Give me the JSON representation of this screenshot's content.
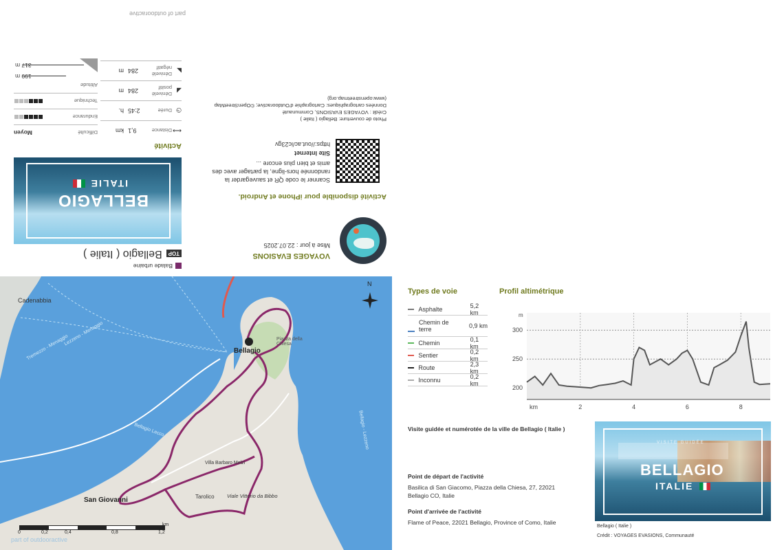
{
  "flip": {
    "brand": "part of outdooractive",
    "category": "Balade urbaine",
    "top_badge": "TOP",
    "title": "Bellagio ( Italie )",
    "section_title": "Activité",
    "stats": [
      {
        "label": "Distance",
        "value": "9,1",
        "unit": "km"
      },
      {
        "label": "Durée",
        "value": "2:45",
        "unit": "h."
      },
      {
        "label": "Dénivelé positif",
        "value": "284",
        "unit": "m"
      },
      {
        "label": "Dénivelé négatif",
        "value": "284",
        "unit": "m"
      }
    ],
    "ratings": [
      {
        "label": "Difficulté",
        "value": "Moyen"
      },
      {
        "label": "Endurance",
        "value": ""
      },
      {
        "label": "Technique",
        "value": ""
      },
      {
        "label": "Altitude",
        "value": ""
      }
    ],
    "altitude_max": "317 m",
    "altitude_min": "199 m",
    "cover_title": "BELLAGIO",
    "cover_subtitle": "ITALIE",
    "author": "VOYAGES EVASIONS",
    "updated": "Mise à jour : 22.07.2025",
    "app_title": "Activité disponible pour iPhone et Android.",
    "app_text": "Scanner le code QR et sauvegarder la randonnée hors-ligne, la partager avec des amis et bien plus encore ...",
    "site_label": "Site Internet",
    "site_url": "https://outdooractive.com/fr/r/...",
    "site_short": "https://out.ac/ic23gv",
    "credits_line1": "Photo de couverture: Bellagio ( Italie )",
    "credits_line2": "Crédit : VOYAGES EVASIONS, Communauté",
    "credits_line3": "Données cartographiques: Cartographie d'Outdooractive; ©OpenStreetMap",
    "credits_line4": "(www.openstreetmap.org)"
  },
  "map": {
    "labels": [
      "Cadenabbia",
      "Bellagio",
      "San Giovanni",
      "Tarolico",
      "Villa Barbaro Melzi",
      "Viale Vittorio da Bibbo",
      "Piazza della Chiesa",
      "Tremezzo - Menaggio",
      "Lezzeno - Menaggio",
      "Bellagio Lecco",
      "Bellagio - Lezzeno"
    ],
    "scale_ticks": [
      "0",
      "0,2",
      "0,4",
      "0,8",
      "1,2"
    ],
    "scale_unit": "km",
    "north": "N",
    "brand": "part of outdooractive"
  },
  "legend": {
    "title": "Types de voie",
    "items": [
      {
        "name": "Asphalte",
        "value": "5,2 km",
        "color": "#777777"
      },
      {
        "name": "Chemin de terre",
        "value": "0,9 km",
        "color": "#4a7fc0"
      },
      {
        "name": "Chemin",
        "value": "0,1 km",
        "color": "#5cb85c"
      },
      {
        "name": "Sentier",
        "value": "0,2 km",
        "color": "#e05a4f"
      },
      {
        "name": "Route",
        "value": "2,3 km",
        "color": "#222222"
      },
      {
        "name": "Inconnu",
        "value": "0,2 km",
        "color": "#aaaaaa"
      }
    ]
  },
  "profile": {
    "title": "Profil altimétrique",
    "y_unit": "m",
    "x_unit": "km",
    "y_ticks": [
      "300",
      "250",
      "200"
    ],
    "x_ticks": [
      "2",
      "4",
      "6",
      "8"
    ]
  },
  "chart_data": {
    "type": "line",
    "title": "Profil altimétrique",
    "xlabel": "km",
    "ylabel": "m",
    "ylim": [
      180,
      330
    ],
    "xlim": [
      0,
      9.1
    ],
    "x": [
      0,
      0.3,
      0.6,
      0.9,
      1.2,
      1.5,
      1.8,
      2.1,
      2.4,
      2.7,
      3.0,
      3.3,
      3.6,
      3.9,
      4.0,
      4.2,
      4.4,
      4.6,
      4.8,
      5.0,
      5.3,
      5.6,
      5.8,
      6.0,
      6.2,
      6.5,
      6.8,
      7.0,
      7.2,
      7.5,
      7.8,
      8.0,
      8.2,
      8.3,
      8.5,
      8.7,
      9.1
    ],
    "y": [
      210,
      220,
      205,
      225,
      205,
      203,
      202,
      201,
      200,
      204,
      206,
      208,
      212,
      205,
      250,
      270,
      265,
      240,
      245,
      250,
      240,
      250,
      260,
      265,
      250,
      210,
      205,
      235,
      240,
      248,
      262,
      290,
      315,
      270,
      210,
      206,
      207
    ]
  },
  "info": {
    "description": "Visite guidée et numérotée de la ville de Bellagio ( Italie )",
    "start_title": "Point de départ de l'activité",
    "start_text": "Basilica di San Giacomo, Piazza della Chiesa, 27, 22021 Bellagio CO, Italie",
    "end_title": "Point d'arrivée de l'activité",
    "end_text": "Flame of Peace, 22021 Bellagio, Province of Como, Italie",
    "photo_title": "BELLAGIO",
    "photo_subtitle": "ITALIE",
    "photo_overlay": "VISITE GUIDÉE",
    "caption": "Bellagio ( Italie )",
    "credit": "Crédit : VOYAGES EVASIONS, Communauté"
  }
}
